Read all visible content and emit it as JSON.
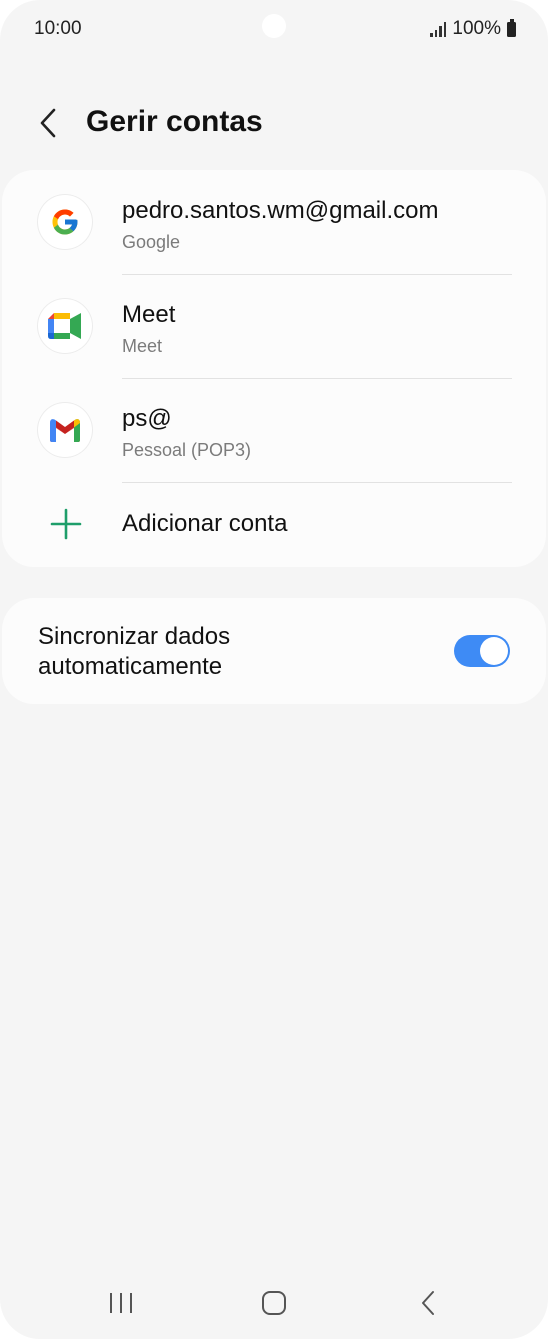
{
  "status_bar": {
    "time": "10:00",
    "battery": "100%"
  },
  "header": {
    "title": "Gerir contas",
    "back_icon": "chevron-left-icon"
  },
  "accounts": [
    {
      "name": "pedro.santos.wm@gmail.com",
      "type": "Google",
      "icon": "google-icon"
    },
    {
      "name": "Meet",
      "type": "Meet",
      "icon": "meet-icon"
    },
    {
      "name": "ps@",
      "type": "Pessoal (POP3)",
      "icon": "gmail-icon"
    }
  ],
  "add_account": {
    "label": "Adicionar conta",
    "icon": "plus-icon",
    "color": "#1e9e6a"
  },
  "sync": {
    "label": "Sincronizar dados automaticamente",
    "enabled": true,
    "accent_color": "#3e8bf5"
  },
  "nav_bar": {
    "icons": [
      "recent-apps-icon",
      "home-icon",
      "back-icon"
    ]
  }
}
